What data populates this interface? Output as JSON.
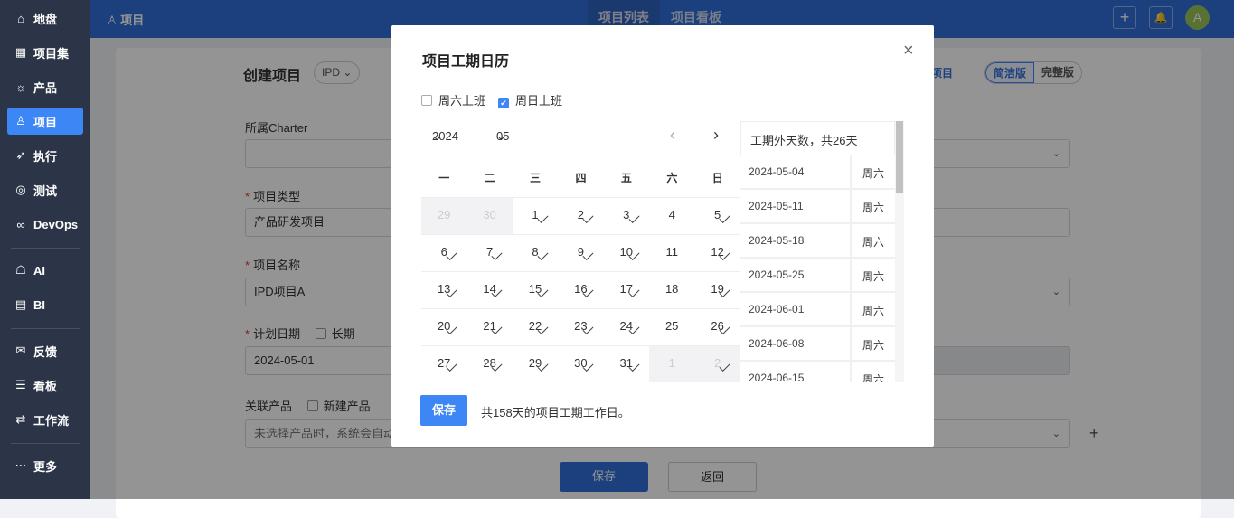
{
  "sidebar": {
    "items": [
      {
        "icon": "⌂",
        "label": "地盘",
        "name": "home"
      },
      {
        "icon": "▦",
        "label": "项目集",
        "name": "program"
      },
      {
        "icon": "☼",
        "label": "产品",
        "name": "product"
      },
      {
        "icon": "♙",
        "label": "项目",
        "name": "project",
        "active": true
      },
      {
        "icon": "➶",
        "label": "执行",
        "name": "execution"
      },
      {
        "icon": "◎",
        "label": "测试",
        "name": "test"
      },
      {
        "icon": "∞",
        "label": "DevOps",
        "name": "devops"
      },
      {
        "icon": "☖",
        "label": "AI",
        "name": "ai"
      },
      {
        "icon": "▤",
        "label": "BI",
        "name": "bi"
      },
      {
        "icon": "✉",
        "label": "反馈",
        "name": "feedback"
      },
      {
        "icon": "☰",
        "label": "看板",
        "name": "kanban"
      },
      {
        "icon": "⇄",
        "label": "工作流",
        "name": "workflow"
      },
      {
        "icon": "⋯",
        "label": "更多",
        "name": "more"
      }
    ]
  },
  "topbar": {
    "crumb": "项目",
    "tabs": [
      "项目列表",
      "项目看板"
    ],
    "avatar": "A",
    "add": "+",
    "bell": "🔔"
  },
  "page": {
    "title": "创建项目",
    "model": "IPD",
    "copy_link": "项目",
    "modes": [
      "简洁版",
      "完整版"
    ],
    "charter_label": "所属Charter",
    "type_label": "项目类型",
    "type_value": "产品研发项目",
    "name_label": "项目名称",
    "name_value": "IPD项目A",
    "date_label": "计划日期",
    "longterm": "长期",
    "start_date": "2024-05-01",
    "product_label": "关联产品",
    "new_product": "新建产品",
    "product_placeholder": "未选择产品时，系统会自动",
    "save": "保存",
    "back": "返回"
  },
  "modal": {
    "title": "项目工期日历",
    "close": "×",
    "sat_label": "周六上班",
    "sat_checked": false,
    "sun_label": "周日上班",
    "sun_checked": true,
    "year": "2024",
    "month": "05",
    "weekdays": [
      "一",
      "二",
      "三",
      "四",
      "五",
      "六",
      "日"
    ],
    "days": [
      {
        "d": "29",
        "o": true,
        "c": false
      },
      {
        "d": "30",
        "o": true,
        "c": false
      },
      {
        "d": "1",
        "c": true
      },
      {
        "d": "2",
        "c": true
      },
      {
        "d": "3",
        "c": true
      },
      {
        "d": "4",
        "c": false
      },
      {
        "d": "5",
        "c": true
      },
      {
        "d": "6",
        "c": true
      },
      {
        "d": "7",
        "c": true
      },
      {
        "d": "8",
        "c": true
      },
      {
        "d": "9",
        "c": true
      },
      {
        "d": "10",
        "c": true
      },
      {
        "d": "11",
        "c": false
      },
      {
        "d": "12",
        "c": true
      },
      {
        "d": "13",
        "c": true
      },
      {
        "d": "14",
        "c": true
      },
      {
        "d": "15",
        "c": true
      },
      {
        "d": "16",
        "c": true
      },
      {
        "d": "17",
        "c": true
      },
      {
        "d": "18",
        "c": false
      },
      {
        "d": "19",
        "c": true
      },
      {
        "d": "20",
        "c": true
      },
      {
        "d": "21",
        "c": true
      },
      {
        "d": "22",
        "c": true
      },
      {
        "d": "23",
        "c": true
      },
      {
        "d": "24",
        "c": true
      },
      {
        "d": "25",
        "c": false
      },
      {
        "d": "26",
        "c": true
      },
      {
        "d": "27",
        "c": true
      },
      {
        "d": "28",
        "c": true
      },
      {
        "d": "29",
        "c": true
      },
      {
        "d": "30",
        "c": true
      },
      {
        "d": "31",
        "c": true
      },
      {
        "d": "1",
        "o": true,
        "c": false
      },
      {
        "d": "2",
        "o": true,
        "c": true
      }
    ],
    "off_header": "工期外天数，共26天",
    "off_days": [
      {
        "date": "2024-05-04",
        "wd": "周六"
      },
      {
        "date": "2024-05-11",
        "wd": "周六"
      },
      {
        "date": "2024-05-18",
        "wd": "周六"
      },
      {
        "date": "2024-05-25",
        "wd": "周六"
      },
      {
        "date": "2024-06-01",
        "wd": "周六"
      },
      {
        "date": "2024-06-08",
        "wd": "周六"
      },
      {
        "date": "2024-06-15",
        "wd": "周六"
      }
    ],
    "save": "保存",
    "summary": "共158天的项目工期工作日。"
  }
}
